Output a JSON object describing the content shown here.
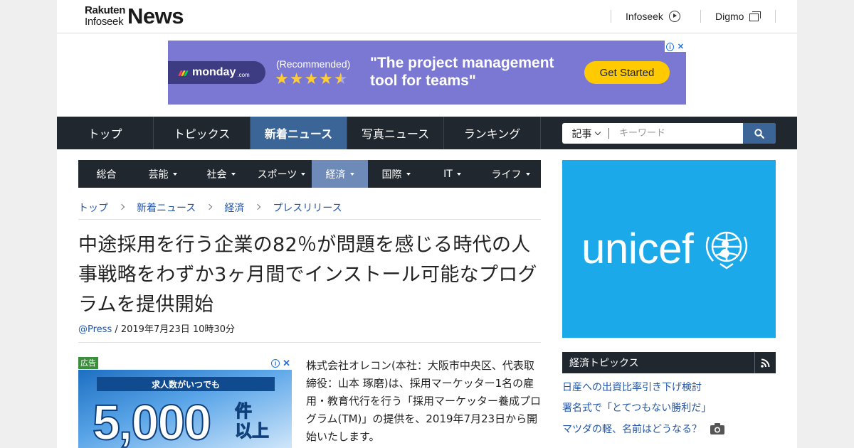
{
  "header": {
    "logo_line1": "Rakuten",
    "logo_line2": "Infoseek",
    "logo_main": "News",
    "links": [
      {
        "label": "Infoseek",
        "icon": "arrow-circle-icon"
      },
      {
        "label": "Digmo",
        "icon": "window-stack-icon"
      }
    ]
  },
  "top_ad": {
    "brand": "monday",
    "brand_suffix": ".com",
    "recommended": "(Recommended)",
    "rating_stars": 4.5,
    "tagline": "\"The project management tool for teams\"",
    "cta": "Get Started",
    "colors": {
      "background": "#7b78d3",
      "pill": "#3d3c82",
      "cta": "#ffcb00"
    }
  },
  "nav": {
    "items": [
      "トップ",
      "トピックス",
      "新着ニュース",
      "写真ニュース",
      "ランキング"
    ],
    "active_index": 2,
    "search_scope": "記事",
    "search_placeholder": "キーワード"
  },
  "subnav": {
    "items": [
      "総合",
      "芸能",
      "社会",
      "スポーツ",
      "経済",
      "国際",
      "IT",
      "ライフ"
    ],
    "has_dropdown": [
      false,
      true,
      true,
      true,
      true,
      true,
      true,
      true
    ],
    "active_index": 4
  },
  "breadcrumb": [
    "トップ",
    "新着ニュース",
    "経済",
    "プレスリリース"
  ],
  "article": {
    "title": "中途採用を行う企業の82％が問題を感じる時代の人事戦略をわずか3ヶ月間でインストール可能なプログラムを提供開始",
    "source": "@Press",
    "date": " / 2019年7月23日 10時30分",
    "body": "株式会社オレコン(本社：大阪市中央区、代表取締役：山本 琢磨)は、採用マーケッター1名の雇用・教育代行を行う「採用マーケッター養成プログラム(TM)」の提供を、2019年7月23日から開始いたします。"
  },
  "inline_ad": {
    "label": "広告",
    "stripe": "求人数がいつでも",
    "number": "5,000",
    "unit_line1": "件",
    "unit_line2": "以上"
  },
  "unicef": {
    "text": "unicef",
    "color": "#1ca9ea"
  },
  "topics": {
    "title": "経済トピックス",
    "items": [
      {
        "text": "日産への出資比率引き下げ検討",
        "photo": false
      },
      {
        "text": "署名式で「とてつもない勝利だ」",
        "photo": false
      },
      {
        "text": "マツダの軽、名前はどうなる？",
        "photo": true
      }
    ]
  }
}
